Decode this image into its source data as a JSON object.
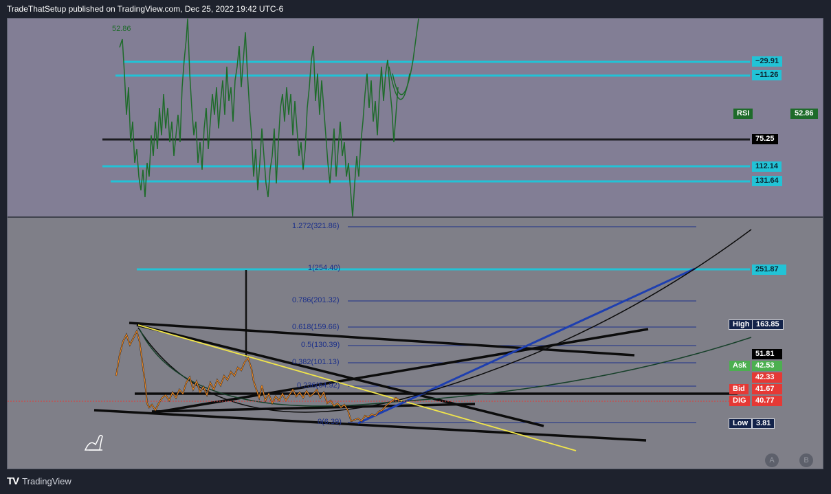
{
  "header": {
    "publisher": "TradeThatSetup published on TradingView.com, Dec 25, 2022 19:42 UTC-6"
  },
  "rsi_pane": {
    "value_label": "52.86",
    "rsi_tag": "RSI",
    "rsi_value": "52.86",
    "levels": [
      "−29.91",
      "−11.26",
      "75.25",
      "112.14",
      "131.64"
    ]
  },
  "price_pane": {
    "fib_labels": [
      "1.272(321.86)",
      "1(254.40)",
      "0.786(201.32)",
      "0.618(159.66)",
      "0.5(130.39)",
      "0.382(101.13)",
      "0.236(64.92)",
      "0(6.39)"
    ],
    "level_251": "251.87",
    "high_label": "High",
    "high_value": "163.85",
    "last_value": "51.81",
    "ask_label": "Ask",
    "ask_value": "42.53",
    "mid_value": "42.33",
    "bid_label": "Bid",
    "bid_value": "41.67",
    "dig_label": "DIG",
    "dig_value": "40.77",
    "low_label": "Low",
    "low_value": "3.81"
  },
  "footer": {
    "brand": "TradingView",
    "btn_a": "A",
    "btn_b": "B"
  },
  "colors": {
    "cyan": "#22c3d6",
    "rsi_green": "#1e6b2a",
    "yellow": "#f2e64a",
    "blue": "#1e3fb0",
    "ask_green": "#4caf50",
    "bid_red": "#e53935",
    "navy": "#13234a"
  }
}
